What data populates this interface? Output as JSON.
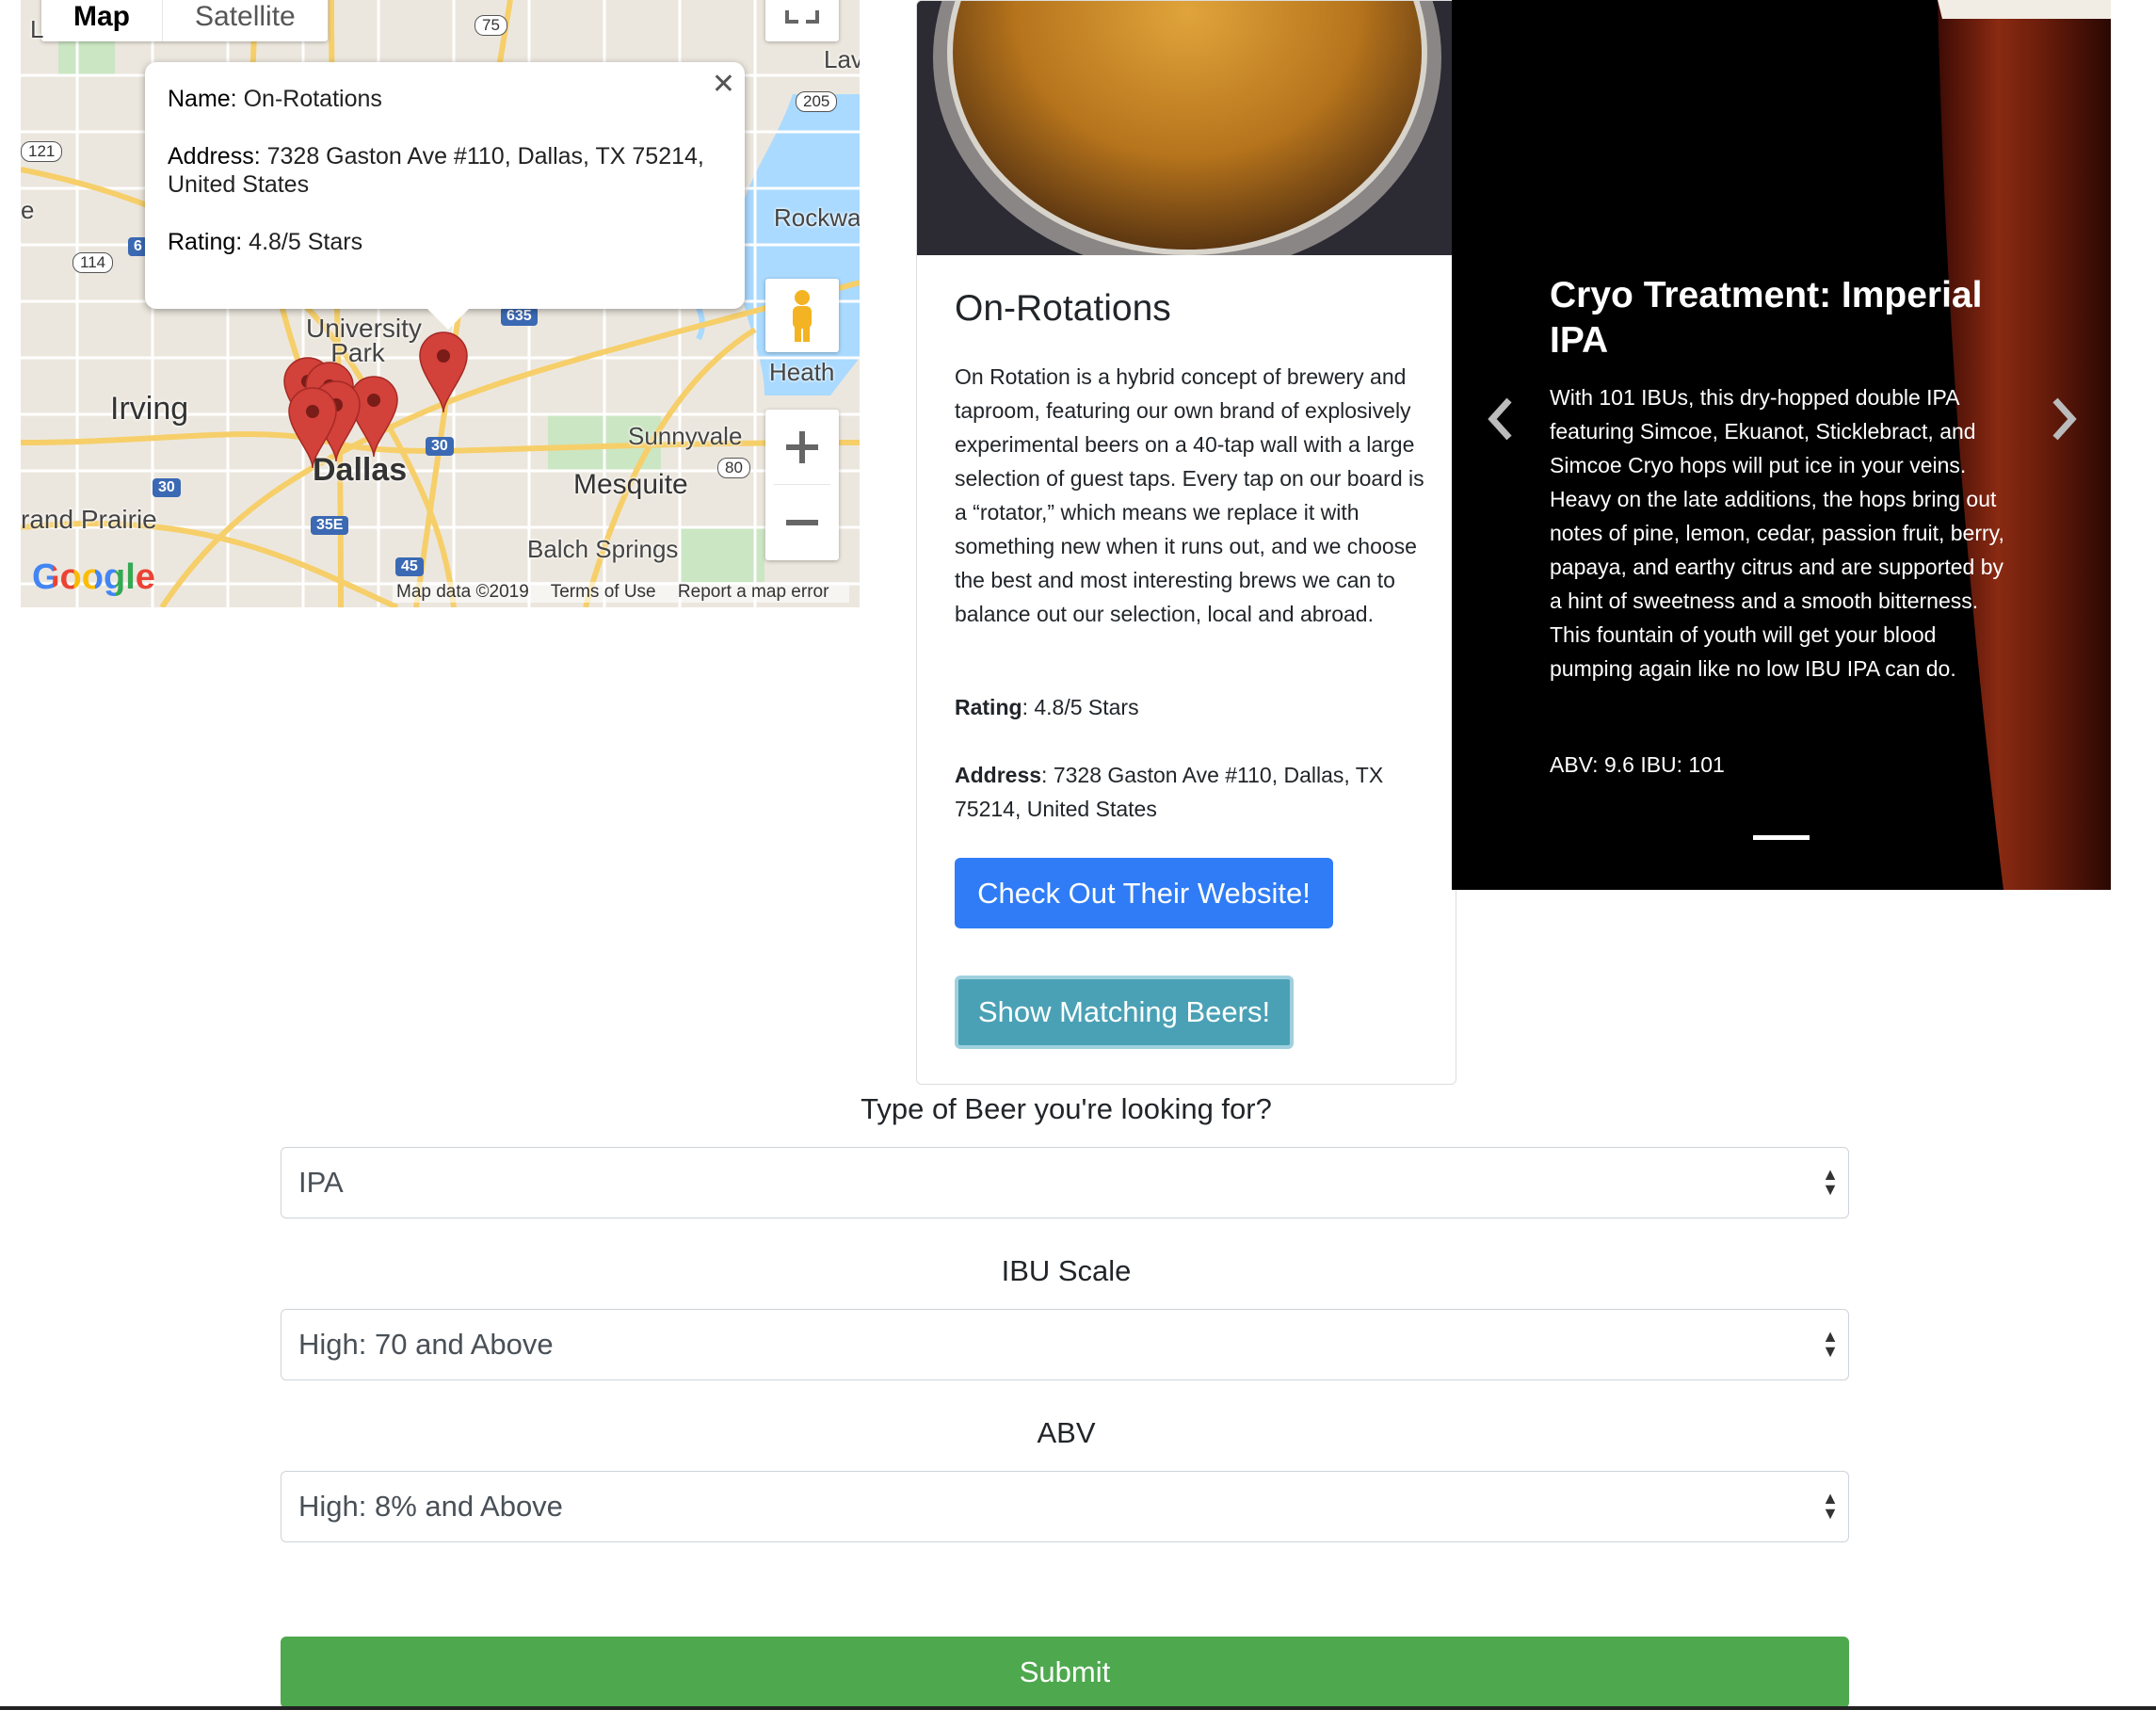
{
  "map": {
    "type_tabs": [
      "Map",
      "Satellite"
    ],
    "info_window": {
      "name_label": "Name:",
      "name_value": "On-Rotations",
      "address_label": "Address:",
      "address_value": "7328 Gaston Ave #110, Dallas, TX 75214, United States",
      "rating_label": "Rating:",
      "rating_value": "4.8/5 Stars"
    },
    "labels": {
      "university_park": "University Park",
      "irving": "Irving",
      "dallas": "Dallas",
      "mesquite": "Mesquite",
      "sunnyvale": "Sunnyvale",
      "grand_prairie": "rand Prairie",
      "balch_springs": "Balch Springs",
      "heath": "Heath",
      "rockwall": "Rockwal",
      "lav": "Lav",
      "l": "L",
      "e": "e"
    },
    "shields": {
      "s75": "75",
      "s205": "205",
      "s121": "121",
      "s114": "114",
      "s6": "6",
      "s635": "635",
      "s30a": "30",
      "s30b": "30",
      "s80": "80",
      "s35e": "35E",
      "s45": "45"
    },
    "logo": "Google",
    "footer": {
      "map_data": "Map data ©2019",
      "terms": "Terms of Use",
      "report": "Report a map error"
    }
  },
  "card": {
    "title": "On-Rotations",
    "description": "On Rotation is a hybrid concept of brewery and taproom, featuring our own brand of explosively experimental beers on a 40-tap wall with a large selection of guest taps. Every tap on our board is a “rotator,” which means we replace it with something new when it runs out, and we choose the best and most interesting brews we can to balance out our selection, local and abroad.",
    "rating_label": "Rating",
    "rating_value": ": 4.8/5 Stars",
    "address_label": "Address",
    "address_value": ": 7328 Gaston Ave #110, Dallas, TX 75214, United States",
    "website_button": "Check Out Their Website!",
    "match_button": "Show Matching Beers!"
  },
  "carousel": {
    "title": "Cryo Treatment: Imperial IPA",
    "description": "With 101 IBUs, this dry-hopped double IPA featuring Simcoe, Ekuanot, Sticklebract, and Simcoe Cryo hops will put ice in your veins. Heavy on the late additions, the hops bring out notes of pine, lemon, cedar, passion fruit, berry, papaya, and earthy citrus and are supported by a hint of sweetness and a smooth bitterness. This fountain of youth will get your blood pumping again like no low IBU IPA can do.",
    "stats": "ABV: 9.6 IBU: 101"
  },
  "form": {
    "type_label": "Type of Beer you're looking for?",
    "type_value": "IPA",
    "ibu_label": "IBU Scale",
    "ibu_value": "High: 70 and Above",
    "abv_label": "ABV",
    "abv_value": "High: 8% and Above",
    "submit": "Submit"
  },
  "colors": {
    "primary": "#2f7cf6",
    "info": "#4aa1b5",
    "success": "#4ea84e",
    "marker": "#d2413a"
  }
}
